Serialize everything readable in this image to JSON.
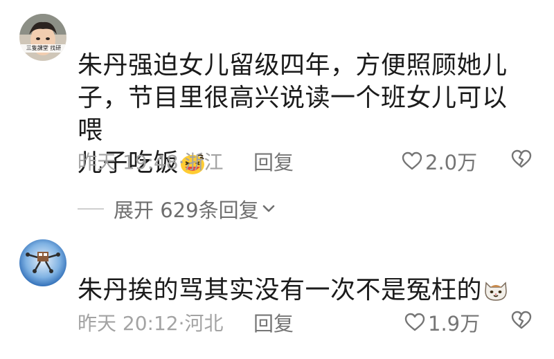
{
  "comments": [
    {
      "avatar_caption": "三隻課堂 找研",
      "text_lines": [
        "朱丹强迫女儿留级四年，方便照顾她儿",
        "子，节目里很高兴说读一个班女儿可以喂",
        "儿子吃饭"
      ],
      "emoji": "grinning-squint-emoji",
      "meta": "昨天 19:48·浙江",
      "reply_label": "回复",
      "like_count": "2.0万",
      "icons": {
        "like": "heart-outline-icon",
        "dislike": "broken-heart-icon"
      }
    },
    {
      "text_lines": [
        "朱丹挨的骂其实没有一次不是冤枉的"
      ],
      "emoji": "cat-face-emoji",
      "meta": "昨天 20:12·河北",
      "reply_label": "回复",
      "like_count": "1.9万",
      "icons": {
        "like": "heart-outline-icon",
        "dislike": "broken-heart-icon"
      }
    }
  ],
  "expand_replies": {
    "label": "展开 629条回复",
    "icon": "chevron-down-icon"
  },
  "colors": {
    "text": "#1b1b1b",
    "meta": "#a3a3a3",
    "action": "#757575"
  }
}
